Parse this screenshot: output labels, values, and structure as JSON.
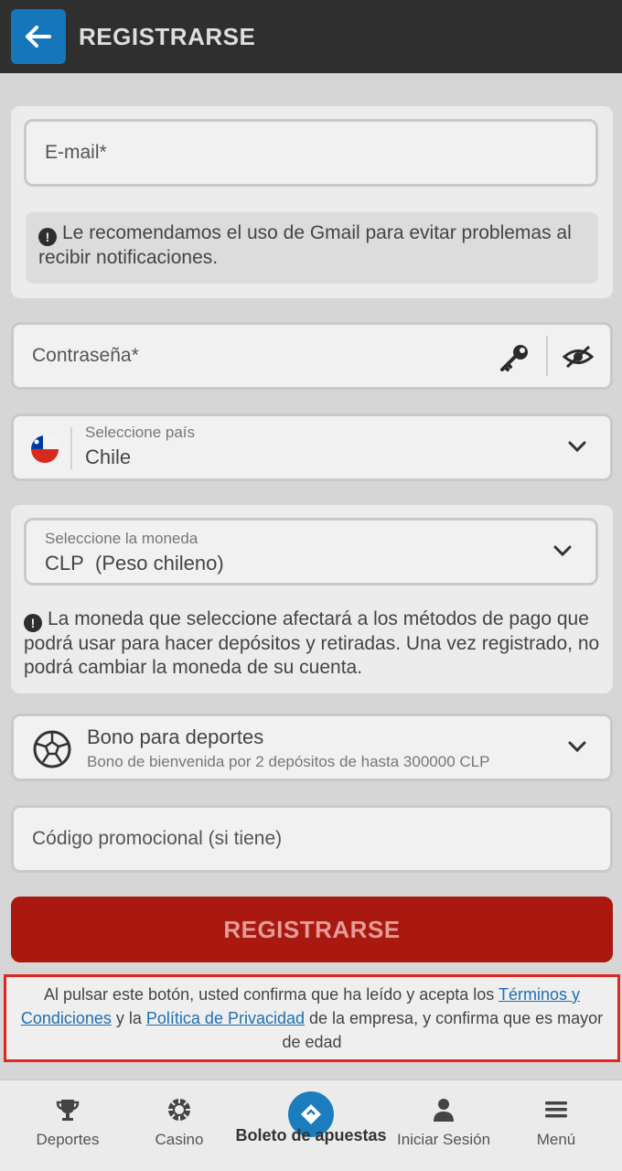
{
  "header": {
    "title": "REGISTRARSE"
  },
  "email": {
    "placeholder": "E-mail*",
    "note": "Le recomendamos el uso de Gmail para evitar problemas al recibir notificaciones."
  },
  "password": {
    "placeholder": "Contraseña*"
  },
  "country": {
    "label": "Seleccione país",
    "value": "Chile"
  },
  "currency": {
    "label": "Seleccione la moneda",
    "code": "CLP",
    "name": "(Peso chileno)",
    "note": "La moneda que seleccione afectará a los métodos de pago que podrá usar para hacer depósitos y retiradas. Una vez registrado, no podrá cambiar la moneda de su cuenta."
  },
  "bonus": {
    "title": "Bono para deportes",
    "subtitle": "Bono de bienvenida por 2 depósitos de hasta 300000 CLP"
  },
  "promo": {
    "placeholder": "Código promocional (si tiene)"
  },
  "register_button": "REGISTRARSE",
  "consent": {
    "part1": "Al pulsar este botón, usted confirma que ha leído y acepta los ",
    "terms_link": "Términos y Condiciones",
    "part2": " y la ",
    "privacy_link": "Política de Privacidad",
    "part3": " de la empresa, y confirma que es mayor de edad"
  },
  "bottom_nav": {
    "sports": "Deportes",
    "casino": "Casino",
    "betslip": "Boleto de apuestas",
    "login": "Iniciar Sesión",
    "menu": "Menú"
  },
  "colors": {
    "header_bg": "#2f2f2f",
    "accent_blue": "#1577b9",
    "register_red": "#a9190f",
    "highlight_border": "#e0261f"
  }
}
